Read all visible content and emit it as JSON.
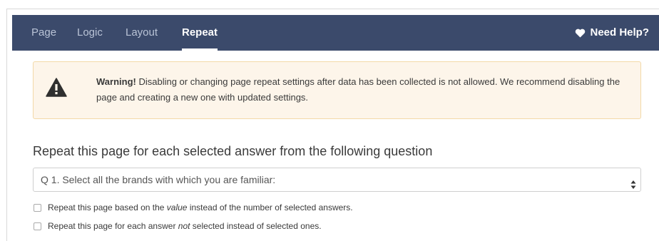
{
  "tabs": [
    {
      "label": "Page"
    },
    {
      "label": "Logic"
    },
    {
      "label": "Layout"
    },
    {
      "label": "Repeat"
    }
  ],
  "help": {
    "label": "Need Help?",
    "icon": "heart-icon"
  },
  "warning": {
    "icon": "warning-triangle-icon",
    "bold": "Warning!",
    "text": " Disabling or changing page repeat settings after data has been collected is not allowed. We recommend disabling the page and creating a new one with updated settings."
  },
  "section_title": "Repeat this page for each selected answer from the following question",
  "question_select": {
    "value": "Q 1. Select all the brands with which you are familiar:"
  },
  "options": [
    {
      "before": "Repeat this page based on the ",
      "emph": "value",
      "after": " instead of the number of selected answers."
    },
    {
      "before": "Repeat this page for each answer ",
      "emph": "not",
      "after": " selected instead of selected ones."
    }
  ]
}
